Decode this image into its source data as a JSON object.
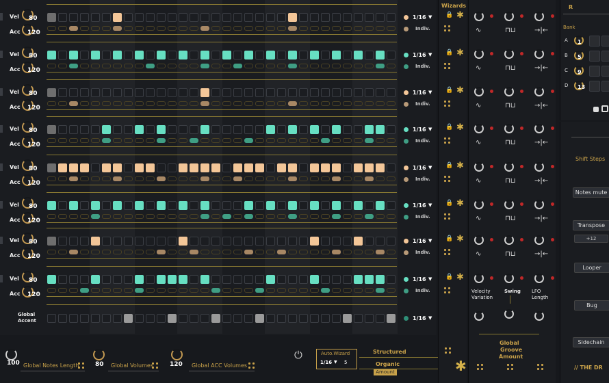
{
  "rows": [
    {
      "color": "#f3c698",
      "dot": "#f3c698",
      "accdot": "#b89a78",
      "accColor": "#a88865",
      "steps": [
        2,
        0,
        0,
        0,
        0,
        0,
        0,
        0,
        0,
        0,
        0,
        1,
        0,
        0,
        0,
        0,
        0,
        0,
        0,
        0,
        0,
        0,
        0,
        0,
        0,
        0,
        0,
        0,
        0,
        0,
        0,
        0
      ],
      "accents": [
        0,
        0,
        0,
        0,
        0,
        1,
        0,
        0,
        0,
        0,
        0,
        1,
        0,
        0,
        0,
        0,
        0,
        0,
        0,
        0,
        0,
        0,
        0,
        0,
        0,
        0,
        0,
        0,
        0,
        0,
        0,
        0
      ],
      "rate": "1/16",
      "mode": "Indiv."
    },
    {
      "color": "#67dfc2",
      "dot": "#67dfc2",
      "accdot": "#3f9e84",
      "accColor": "#3f9e84",
      "steps": [
        1,
        0,
        0,
        0,
        0,
        0,
        0,
        0,
        0,
        0,
        0,
        0,
        0,
        0,
        0,
        0,
        0,
        0,
        0,
        0,
        0,
        0,
        0,
        0,
        0,
        0,
        0,
        0,
        0,
        0,
        0,
        0
      ],
      "accents": [
        0,
        0,
        0,
        0,
        0,
        0,
        0,
        0,
        0,
        0,
        0,
        0,
        0,
        0,
        0,
        0,
        0,
        0,
        0,
        0,
        0,
        0,
        0,
        0,
        0,
        0,
        0,
        0,
        0,
        0,
        0,
        0
      ],
      "rate": "1/16",
      "mode": "Indiv."
    },
    {
      "color": "#f3c698",
      "dot": "#f3c698",
      "accdot": "#b89a78",
      "accColor": "#a88865",
      "steps": [
        2,
        0,
        0,
        0,
        0,
        0,
        0,
        0,
        0,
        0,
        0,
        0,
        0,
        0,
        0,
        0,
        0,
        0,
        0,
        0,
        0,
        0,
        0,
        0,
        0,
        0,
        0,
        0,
        0,
        0,
        0,
        0
      ],
      "accents": [
        0,
        0,
        0,
        0,
        0,
        0,
        0,
        0,
        0,
        0,
        0,
        0,
        0,
        0,
        0,
        0,
        0,
        0,
        0,
        0,
        0,
        0,
        0,
        0,
        0,
        0,
        0,
        0,
        0,
        0,
        0,
        0
      ],
      "rate": "1/16",
      "mode": "Indiv."
    },
    {
      "color": "#67dfc2",
      "dot": "#67dfc2",
      "accdot": "#3f9e84",
      "accColor": "#3f9e84",
      "steps": [
        2,
        0,
        0,
        0,
        0,
        0,
        0,
        0,
        0,
        0,
        0,
        0,
        0,
        0,
        0,
        0,
        0,
        0,
        0,
        0,
        0,
        0,
        0,
        0,
        0,
        0,
        0,
        0,
        0,
        0,
        0,
        0
      ],
      "accents": [
        0,
        0,
        0,
        0,
        0,
        0,
        0,
        0,
        0,
        0,
        0,
        0,
        0,
        0,
        0,
        0,
        0,
        0,
        0,
        0,
        0,
        0,
        0,
        0,
        0,
        0,
        0,
        0,
        0,
        0,
        0,
        0
      ],
      "rate": "1/16",
      "mode": "Indiv."
    },
    {
      "color": "#f3c698",
      "dot": "#f3c698",
      "accdot": "#b89a78",
      "accColor": "#a88865",
      "steps": [
        2,
        0,
        0,
        0,
        0,
        0,
        0,
        0,
        0,
        0,
        0,
        0,
        0,
        0,
        0,
        0,
        0,
        0,
        0,
        0,
        0,
        0,
        0,
        0,
        0,
        0,
        0,
        0,
        0,
        0,
        0,
        0
      ],
      "accents": [
        0,
        0,
        0,
        0,
        0,
        0,
        0,
        0,
        0,
        0,
        0,
        0,
        0,
        0,
        0,
        0,
        0,
        0,
        0,
        0,
        0,
        0,
        0,
        0,
        0,
        0,
        0,
        0,
        0,
        0,
        0,
        0
      ],
      "rate": "1/16",
      "mode": "Indiv."
    },
    {
      "color": "#67dfc2",
      "dot": "#67dfc2",
      "accdot": "#3f9e84",
      "accColor": "#3f9e84",
      "steps": [
        1,
        0,
        0,
        0,
        0,
        0,
        0,
        0,
        0,
        0,
        0,
        0,
        0,
        0,
        0,
        0,
        0,
        0,
        0,
        0,
        0,
        0,
        0,
        0,
        0,
        0,
        0,
        0,
        0,
        0,
        0,
        0
      ],
      "accents": [
        0,
        0,
        0,
        0,
        0,
        0,
        0,
        0,
        0,
        0,
        0,
        0,
        0,
        0,
        0,
        0,
        0,
        0,
        0,
        0,
        0,
        0,
        0,
        0,
        0,
        0,
        0,
        0,
        0,
        0,
        0,
        0
      ],
      "rate": "1/16",
      "mode": "Indiv."
    },
    {
      "color": "#f3c698",
      "dot": "#f3c698",
      "accdot": "#b89a78",
      "accColor": "#a88865",
      "steps": [
        2,
        0,
        0,
        0,
        0,
        0,
        0,
        0,
        0,
        0,
        0,
        0,
        0,
        0,
        0,
        0,
        0,
        0,
        0,
        0,
        0,
        0,
        0,
        0,
        0,
        0,
        0,
        0,
        0,
        0,
        0,
        0
      ],
      "accents": [
        0,
        0,
        0,
        0,
        0,
        0,
        0,
        0,
        0,
        0,
        0,
        0,
        0,
        0,
        0,
        0,
        0,
        0,
        0,
        0,
        0,
        0,
        0,
        0,
        0,
        0,
        0,
        0,
        0,
        0,
        0,
        0
      ],
      "rate": "1/16",
      "mode": "Indiv."
    },
    {
      "color": "#67dfc2",
      "dot": "#67dfc2",
      "accdot": "#3f9e84",
      "accColor": "#3f9e84",
      "steps": [
        1,
        0,
        0,
        0,
        0,
        0,
        0,
        0,
        0,
        0,
        0,
        0,
        0,
        0,
        0,
        0,
        0,
        0,
        0,
        0,
        0,
        0,
        0,
        0,
        0,
        0,
        0,
        0,
        0,
        0,
        0,
        0
      ],
      "accents": [
        0,
        0,
        0,
        0,
        0,
        0,
        0,
        0,
        0,
        0,
        0,
        0,
        0,
        0,
        0,
        0,
        0,
        0,
        0,
        0,
        0,
        0,
        0,
        0,
        0,
        0,
        0,
        0,
        0,
        0,
        0,
        0
      ],
      "rate": "1/16",
      "mode": "Indiv."
    }
  ],
  "row_labels": {
    "vel": "Vel",
    "acc": "Acc",
    "vel_value": "80",
    "acc_value": "120"
  },
  "global_accent": {
    "label_line1": "Global",
    "label_line2": "Accent",
    "rate": "1/16",
    "steps": [
      0,
      0,
      0,
      0,
      0,
      0,
      0,
      1,
      0,
      0,
      0,
      1,
      0,
      0,
      0,
      1,
      0,
      0,
      0,
      1,
      0,
      0,
      0,
      0,
      0,
      0,
      0,
      1,
      0,
      0,
      0,
      1
    ]
  },
  "bottom": {
    "notes_length_value": "100",
    "notes_length_label": "Global Notes Length",
    "volumes_value": "80",
    "volumes_label": "Global Volumes",
    "acc_volumes_value": "120",
    "acc_volumes_label": "Global ACC Volumes",
    "auto_wizard_label": "Auto.Wizard",
    "auto_wizard_rate": "1/16",
    "auto_wizard_count": "5",
    "structured_label": "Structured",
    "organic_label": "Organic",
    "amount_label": "Amount"
  },
  "wizards": {
    "title": "Wizards"
  },
  "groove": {
    "velocity_variation": "Velocity Variation",
    "swing": "Swing",
    "lfo_length": "LFO Length",
    "title_line1": "Global",
    "title_line2": "Groove",
    "title_line3": "Amount"
  },
  "right_top": {
    "r_label": "R",
    "bank_label": "Bank",
    "banks": [
      {
        "letter": "A",
        "value": "1"
      },
      {
        "letter": "B",
        "value": "5"
      },
      {
        "letter": "C",
        "value": "9"
      },
      {
        "letter": "D",
        "value": "13"
      }
    ]
  },
  "right_side": {
    "shift_steps": "Shift Steps",
    "notes_mute": "Notes mute",
    "transpose": "Transpose",
    "transpose_value": "+12",
    "looper": "Looper",
    "bug": "Bug",
    "sidechain": "Sidechain",
    "footer": "// THE DR"
  },
  "colors": {
    "accent": "#c9a24a",
    "peach": "#f3c698",
    "mint": "#67dfc2",
    "gray": "#7a7a7a"
  }
}
